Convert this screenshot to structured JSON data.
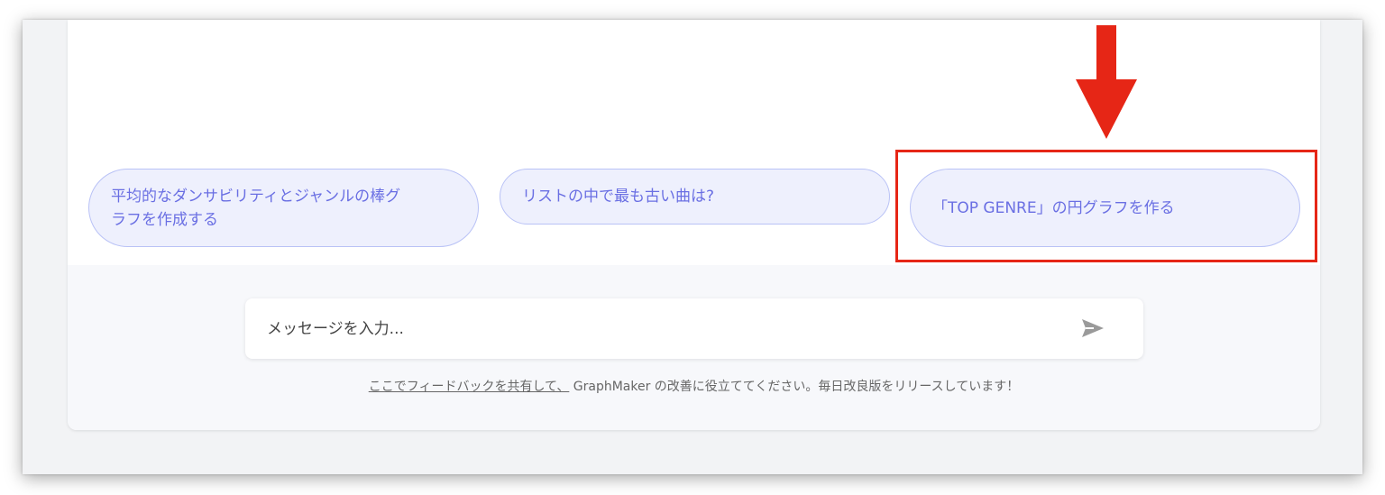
{
  "suggestions": [
    {
      "text": "平均的なダンサビリティとジャンルの棒グラフを作成する"
    },
    {
      "text": "リストの中で最も古い曲は?"
    },
    {
      "text": "「TOP GENRE」の円グラフを作る"
    }
  ],
  "message_input": {
    "placeholder": "メッセージを入力...",
    "value": ""
  },
  "send_icon": "send-icon",
  "footer": {
    "link_text": "ここでフィードバックを共有して、",
    "text": " GraphMaker の改善に役立ててください。毎日改良版をリリースしています！"
  },
  "annotation": {
    "color": "#e62616",
    "arrow_icon": "arrow-down-icon"
  },
  "colors": {
    "chip_bg": "#eef0fd",
    "chip_border": "#b9c2f6",
    "chip_text": "#6a6fe3"
  }
}
